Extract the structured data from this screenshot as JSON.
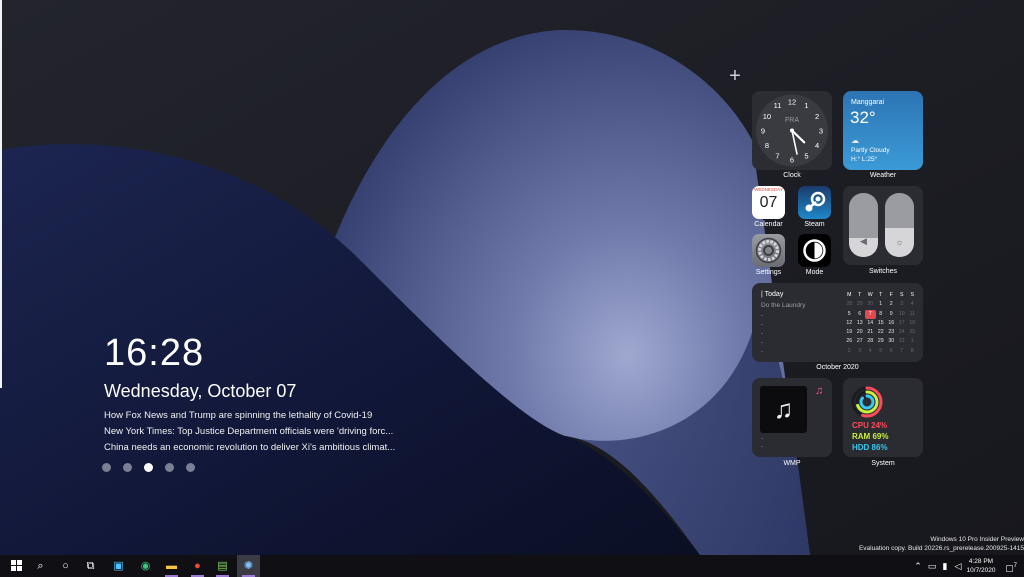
{
  "lock": {
    "time": "16:28",
    "date": "Wednesday, October 07",
    "news": [
      "How Fox News and Trump are spinning the lethality of Covid-19",
      "New York Times: Top Justice Department officials were 'driving forc...",
      "China needs an economic revolution to deliver Xi's ambitious climat..."
    ],
    "page_dots": 5,
    "active_dot": 3
  },
  "add_widget": "+",
  "widgets": {
    "clock": {
      "label": "Clock",
      "face_text": "FRA",
      "numerals": [
        "12",
        "1",
        "2",
        "3",
        "4",
        "5",
        "6",
        "7",
        "8",
        "9",
        "10",
        "11"
      ],
      "hour": 4,
      "minute": 28
    },
    "weather": {
      "label": "Weather",
      "city": "Manggarai",
      "temp": "32°",
      "condition": "Partly Cloudy",
      "hilo": "H:° L:25°"
    },
    "calendar_app": {
      "label": "Calendar",
      "weekday": "WEDNESDAY",
      "day": "07"
    },
    "steam": {
      "label": "Steam"
    },
    "settings": {
      "label": "Settings"
    },
    "mode": {
      "label": "Mode"
    },
    "switches": {
      "label": "Switches",
      "levels": [
        0.3,
        0.45
      ],
      "icons": [
        "speaker-icon",
        "brightness-icon"
      ]
    },
    "calendar": {
      "label": "October 2020",
      "today_header": "| Today",
      "task": "Do the Laundry",
      "dashes": [
        "-",
        "-",
        "-",
        "-",
        "-"
      ],
      "weekdays": [
        "M",
        "T",
        "W",
        "T",
        "F",
        "S",
        "S"
      ],
      "weeks": [
        [
          [
            "28",
            "oth"
          ],
          [
            "29",
            "oth"
          ],
          [
            "30",
            "oth"
          ],
          [
            "1",
            "cur"
          ],
          [
            "2",
            "cur"
          ],
          [
            "3",
            "oth"
          ],
          [
            "4",
            "oth"
          ]
        ],
        [
          [
            "5",
            "cur"
          ],
          [
            "6",
            "cur"
          ],
          [
            "7",
            "today"
          ],
          [
            "8",
            "cur"
          ],
          [
            "9",
            "cur"
          ],
          [
            "10",
            "oth"
          ],
          [
            "11",
            "oth"
          ]
        ],
        [
          [
            "12",
            "cur"
          ],
          [
            "13",
            "cur"
          ],
          [
            "14",
            "cur"
          ],
          [
            "15",
            "cur"
          ],
          [
            "16",
            "cur"
          ],
          [
            "17",
            "oth"
          ],
          [
            "18",
            "oth"
          ]
        ],
        [
          [
            "19",
            "cur"
          ],
          [
            "20",
            "cur"
          ],
          [
            "21",
            "cur"
          ],
          [
            "22",
            "cur"
          ],
          [
            "23",
            "cur"
          ],
          [
            "24",
            "oth"
          ],
          [
            "25",
            "oth"
          ]
        ],
        [
          [
            "26",
            "cur"
          ],
          [
            "27",
            "cur"
          ],
          [
            "28",
            "cur"
          ],
          [
            "29",
            "cur"
          ],
          [
            "30",
            "cur"
          ],
          [
            "31",
            "oth"
          ],
          [
            "1",
            "oth"
          ]
        ],
        [
          [
            "2",
            "oth"
          ],
          [
            "3",
            "oth"
          ],
          [
            "4",
            "oth"
          ],
          [
            "5",
            "oth"
          ],
          [
            "6",
            "oth"
          ],
          [
            "7",
            "oth"
          ],
          [
            "8",
            "oth"
          ]
        ]
      ]
    },
    "wmp": {
      "label": "WMP",
      "dashes": [
        "-",
        "-"
      ]
    },
    "system": {
      "label": "System",
      "cpu": "CPU 24%",
      "ram": "RAM 69%",
      "hdd": "HDD 86%",
      "colors": {
        "cpu": "#ff4b5c",
        "ram": "#c8f03c",
        "hdd": "#37c6ef"
      },
      "rings": [
        0.24,
        0.69,
        0.86
      ]
    }
  },
  "watermark": {
    "line1": "Windows 10 Pro Insider Preview",
    "line2": "Evaluation copy. Build 20226.rs_prerelease.200925-1415"
  },
  "taskbar": {
    "time": "4:28 PM",
    "date": "10/7/2020",
    "notifications": "7"
  },
  "colors": {
    "accent": "#9b7bd4",
    "wallpaper_blue": "#2e3b6e",
    "today": "#e04a52"
  }
}
